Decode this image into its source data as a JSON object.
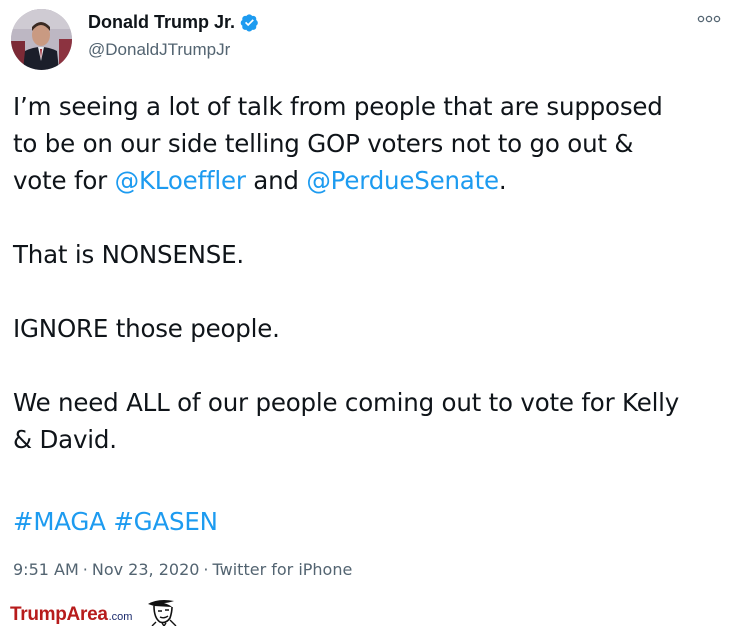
{
  "tweet": {
    "author_name": "Donald Trump Jr.",
    "author_handle": "@DonaldJTrumpJr",
    "verified": true,
    "more_icon": "more-options-icon",
    "body": {
      "p1_a": "I’m seeing a lot of talk from people that are supposed",
      "p1_b": "to be on our side telling GOP voters not to go out &",
      "p1_c_pre": "vote for ",
      "mention1": "@KLoeffler",
      "p1_c_mid": " and ",
      "mention2": "@PerdueSenate",
      "p1_c_end": ".",
      "p2": "That is NONSENSE.",
      "p3": "IGNORE those people.",
      "p4_a": "We need ALL of our people coming out to vote for Kelly",
      "p4_b": "& David."
    },
    "hashtag1": "#MAGA",
    "hashtag2": "#GASEN",
    "time": "9:51 AM",
    "separator": "·",
    "date": "Nov 23, 2020",
    "source": "Twitter for iPhone",
    "colors": {
      "link": "#1d9bf0",
      "verified": "#1d9bf0",
      "muted": "#536471"
    }
  },
  "watermark": {
    "brand": "TrumpArea",
    "suffix": ".com",
    "brand_color": "#b71c1c",
    "icon": "trump-caricature-icon"
  }
}
